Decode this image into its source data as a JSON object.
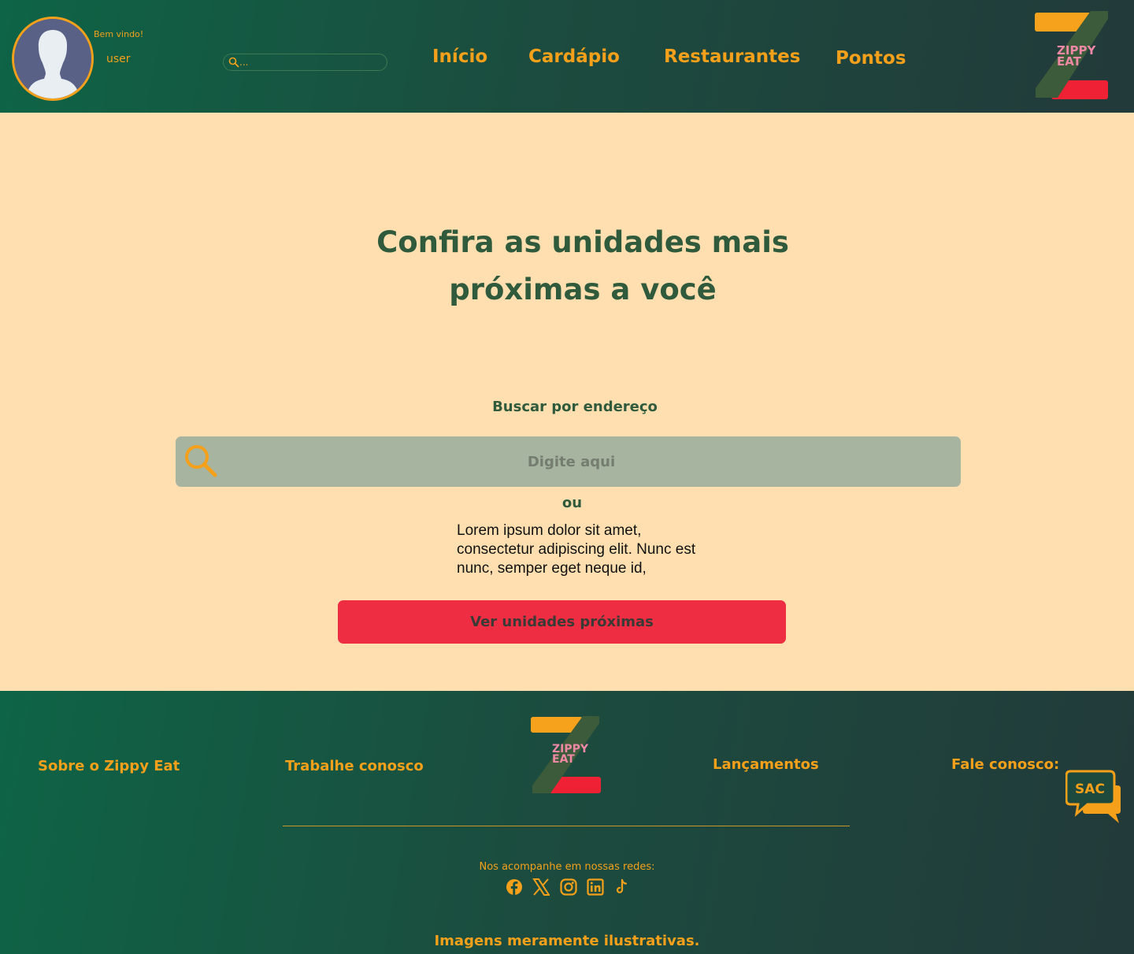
{
  "header": {
    "welcome": "Bem vindo!",
    "username": "user",
    "search_placeholder": "...",
    "nav": [
      "Início",
      "Cardápio",
      "Restaurantes",
      "Pontos"
    ],
    "logo_text_line1": "ZIPPY",
    "logo_text_line2": "EAT"
  },
  "main": {
    "title": "Confira as unidades mais próximas a você",
    "search_label": "Buscar por endereço",
    "search_placeholder": "Digite aqui",
    "or": "ou",
    "description": "Lorem ipsum dolor sit amet, consectetur adipiscing elit. Nunc est nunc, semper eget neque id,",
    "cta": "Ver unidades próximas"
  },
  "footer": {
    "links": [
      "Sobre o Zippy Eat",
      "Trabalhe conosco",
      "Lançamentos",
      "Fale conosco:"
    ],
    "logo_text_line1": "ZIPPY",
    "logo_text_line2": "EAT",
    "sac_label": "SAC",
    "social_label": "Nos acompanhe em nossas redes:",
    "social_icons": [
      "facebook-icon",
      "x-icon",
      "instagram-icon",
      "linkedin-icon",
      "tiktok-icon"
    ],
    "disclaimer": "Imagens meramente ilustrativas."
  },
  "colors": {
    "accent": "#f4a01a",
    "dark_green": "#305a3c",
    "background": "#ffdfb0",
    "cta_red": "#ef2d42",
    "header_gradient_start": "#0e6446",
    "header_gradient_end": "#223a3a"
  }
}
